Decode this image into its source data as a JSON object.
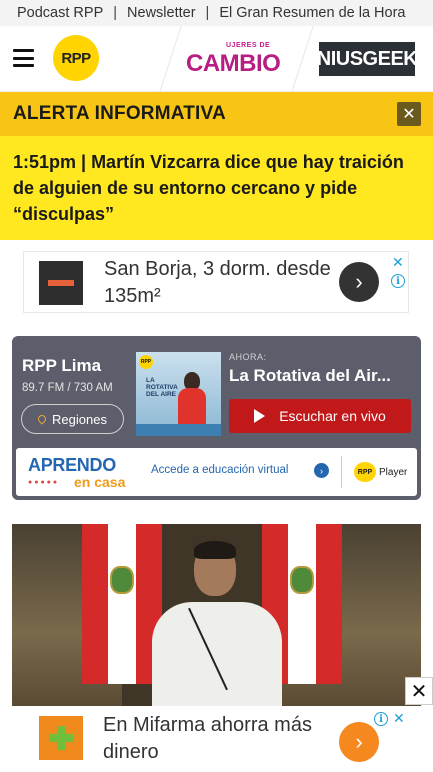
{
  "top_links": [
    "Podcast RPP",
    "Newsletter",
    "El Gran Resumen de la Hora"
  ],
  "header": {
    "logo": "RPP",
    "partner_1_small": "UJERES DE",
    "partner_1_big": "CAMBIO",
    "partner_2": "NIUSGEEK"
  },
  "alert": {
    "title": "ALERTA INFORMATIVA",
    "close": "✕",
    "body": "1:51pm | Martín Vizcarra dice que hay traición de alguien de su entorno cercano y pide “disculpas”"
  },
  "ad_top": {
    "text": "San Borja, 3 dorm. desde 135m²",
    "cta_icon": "chevron-right-icon",
    "close": "✕",
    "info": "i"
  },
  "radio": {
    "station": "RPP Lima",
    "frequency": "89.7 FM / 730 AM",
    "regions_label": "Regiones",
    "now_label": "AHORA:",
    "program": "La Rotativa del Air...",
    "listen_label": "Escuchar en vivo",
    "poster_logo": "RPP",
    "poster_title": "LA ROTATIVA DEL AIRE",
    "aprendo": "APRENDO",
    "en_casa": "en casa",
    "access_label": "Accede a educación virtual",
    "player_logo": "RPP",
    "player_label": "Player"
  },
  "ad_bottom": {
    "text": "En Mifarma ahorra más dinero",
    "close": "✕",
    "info": "i"
  },
  "overlay_close": "✕",
  "colors": {
    "alert_head": "#f9c514",
    "alert_body": "#ffe81f",
    "listen_button": "#c11919",
    "rpp_yellow": "#ffd400"
  }
}
